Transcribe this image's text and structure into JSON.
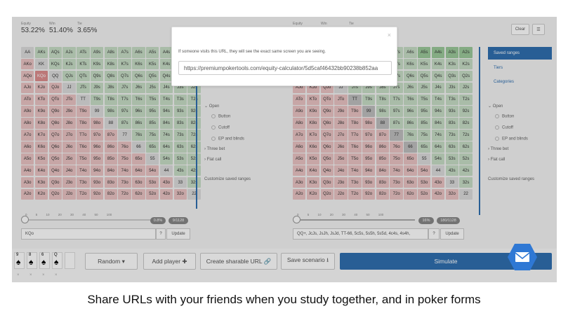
{
  "left": {
    "stats": [
      {
        "label": "Equity",
        "value": "53.22%"
      },
      {
        "label": "Win",
        "value": "51.40%"
      },
      {
        "label": "Tie",
        "value": "3.65%"
      }
    ],
    "slider_ticks": "0 5 10 20 30 40 50 100",
    "pct": "0.8%",
    "combos": "9/1128",
    "range_text": "KQo",
    "question": "?",
    "update": "Update"
  },
  "right": {
    "stats": [
      {
        "label": "Equity",
        "value": ""
      },
      {
        "label": "Win",
        "value": ""
      },
      {
        "label": "Tie",
        "value": ""
      }
    ],
    "slider_ticks": "0 5 10 20 30 40 50 100",
    "pct": "16%",
    "combos": "180/1128",
    "range_text": "QQ+, JcJs, JsJh, JsJd, TT-66, 5c5s, 5s5h, 5s5d, 4c4s, 4s4h,",
    "question": "?",
    "update": "Update"
  },
  "clear_label": "Clear",
  "menu_glyph": "☰",
  "sidebar": {
    "saved": "Saved ranges",
    "tiers": "Tiers",
    "categories": "Categories"
  },
  "tree": {
    "open": "Open",
    "button": "Button",
    "cutoff": "Cutoff",
    "ep": "EP and blinds",
    "three_bet": "Three bet",
    "flat": "Flat call",
    "customize": "Customize saved ranges"
  },
  "modal": {
    "close": "×",
    "text": "If someone visits this URL, they will see the exact same screen you are seeing.",
    "url": "https://premiumpokertools.com/equity-calculator/5d5caf46432bb90238b852aa"
  },
  "bottom": {
    "cards": [
      {
        "rank": "9",
        "suit": "♠"
      },
      {
        "rank": "8",
        "suit": "♠"
      },
      {
        "rank": "6",
        "suit": "♠"
      },
      {
        "rank": "Q",
        "suit": "♠"
      }
    ],
    "x": "×",
    "random": "Random ▾",
    "add_player": "Add player ✚",
    "share": "Create sharable URL 🔗",
    "save": "Save scenario ⭳",
    "simulate": "Simulate"
  },
  "ranks": [
    "A",
    "K",
    "Q",
    "J",
    "T",
    "9",
    "8",
    "7",
    "6",
    "5",
    "4",
    "3",
    "2"
  ],
  "left_highlight": [
    "KQo"
  ],
  "right_grid_rows": [
    [
      "AA",
      "AKs",
      "AQs",
      "AJs",
      "ATs",
      "A9s",
      "A8s",
      "A7s",
      "A6s",
      "A5s",
      "A4s",
      "A3s",
      "A2s"
    ]
  ],
  "caption": "Share URLs with your friends when you study together, and in poker forms",
  "colors": {
    "accent": "#2f6fb0",
    "offsuit": "#eac3c3",
    "suited": "#c7ddc6",
    "pair": "#dcdcdc",
    "selected": "#dd8e8e"
  }
}
